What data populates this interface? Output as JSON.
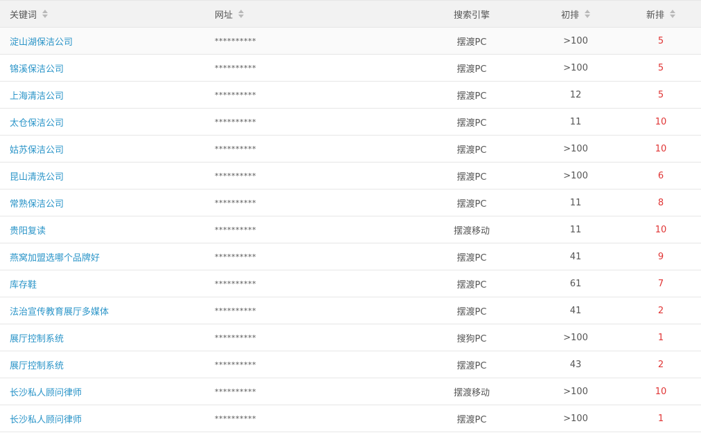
{
  "table": {
    "headers": {
      "keyword": "关键词",
      "url": "网址",
      "engine": "搜索引擎",
      "initial_rank": "初排",
      "new_rank": "新排"
    },
    "rows": [
      {
        "keyword": "淀山湖保洁公司",
        "url": "**********",
        "engine": "摆渡PC",
        "initial_rank": ">100",
        "new_rank": "5"
      },
      {
        "keyword": "锦溪保洁公司",
        "url": "**********",
        "engine": "摆渡PC",
        "initial_rank": ">100",
        "new_rank": "5"
      },
      {
        "keyword": "上海清洁公司",
        "url": "**********",
        "engine": "摆渡PC",
        "initial_rank": "12",
        "new_rank": "5"
      },
      {
        "keyword": "太仓保洁公司",
        "url": "**********",
        "engine": "摆渡PC",
        "initial_rank": "11",
        "new_rank": "10"
      },
      {
        "keyword": "姑苏保洁公司",
        "url": "**********",
        "engine": "摆渡PC",
        "initial_rank": ">100",
        "new_rank": "10"
      },
      {
        "keyword": "昆山清洗公司",
        "url": "**********",
        "engine": "摆渡PC",
        "initial_rank": ">100",
        "new_rank": "6"
      },
      {
        "keyword": "常熟保洁公司",
        "url": "**********",
        "engine": "摆渡PC",
        "initial_rank": "11",
        "new_rank": "8"
      },
      {
        "keyword": "贵阳复读",
        "url": "**********",
        "engine": "摆渡移动",
        "initial_rank": "11",
        "new_rank": "10"
      },
      {
        "keyword": "燕窝加盟选哪个品牌好",
        "url": "**********",
        "engine": "摆渡PC",
        "initial_rank": "41",
        "new_rank": "9"
      },
      {
        "keyword": "库存鞋",
        "url": "**********",
        "engine": "摆渡PC",
        "initial_rank": "61",
        "new_rank": "7"
      },
      {
        "keyword": "法治宣传教育展厅多媒体",
        "url": "**********",
        "engine": "摆渡PC",
        "initial_rank": "41",
        "new_rank": "2"
      },
      {
        "keyword": "展厅控制系统",
        "url": "**********",
        "engine": "搜狗PC",
        "initial_rank": ">100",
        "new_rank": "1"
      },
      {
        "keyword": "展厅控制系统",
        "url": "**********",
        "engine": "摆渡PC",
        "initial_rank": "43",
        "new_rank": "2"
      },
      {
        "keyword": "长沙私人顾问律师",
        "url": "**********",
        "engine": "摆渡移动",
        "initial_rank": ">100",
        "new_rank": "10"
      },
      {
        "keyword": "长沙私人顾问律师",
        "url": "**********",
        "engine": "摆渡PC",
        "initial_rank": ">100",
        "new_rank": "1"
      }
    ]
  },
  "colors": {
    "link": "#2a94c8",
    "new_rank": "#e03434",
    "header_bg": "#f2f2f2",
    "border": "#e6e6e6"
  }
}
